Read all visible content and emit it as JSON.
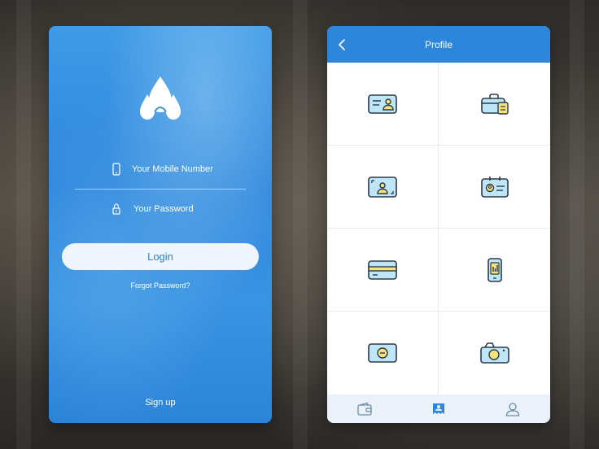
{
  "login": {
    "mobile_placeholder": "Your Mobile Number",
    "password_placeholder": "Your Password",
    "login_label": "Login",
    "forgot_label": "Forgot Password?",
    "signup_label": "Sign up",
    "icons": {
      "logo": "logo-drops",
      "phone": "phone-icon",
      "lock": "lock-icon"
    }
  },
  "profile": {
    "title": "Profile",
    "back_icon": "chevron-left-icon",
    "cards": [
      {
        "icon": "id-card-icon"
      },
      {
        "icon": "briefcase-icon"
      },
      {
        "icon": "photo-id-icon"
      },
      {
        "icon": "badge-icon"
      },
      {
        "icon": "credit-card-icon"
      },
      {
        "icon": "mobile-chart-icon"
      },
      {
        "icon": "coin-card-icon"
      },
      {
        "icon": "camera-icon"
      }
    ],
    "tabs": [
      {
        "icon": "wallet-icon"
      },
      {
        "icon": "profile-card-icon",
        "active": true
      },
      {
        "icon": "user-icon"
      }
    ]
  },
  "colors": {
    "accent": "#2d86d9",
    "icon_fill_blue": "#bfe6f7",
    "icon_fill_yellow": "#f7e27a",
    "icon_stroke": "#2b3a4a",
    "tab_active": "#2d86d9",
    "tab_inactive": "#6a8bab"
  }
}
